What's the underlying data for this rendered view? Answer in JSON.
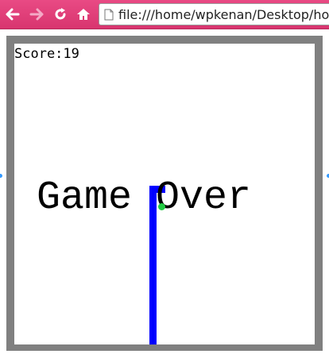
{
  "browser": {
    "url": "file:///home/wpkenan/Desktop/home",
    "icons": {
      "back": "back-arrow-icon",
      "forward": "forward-arrow-icon",
      "reload": "reload-icon",
      "home": "home-icon",
      "page": "page-icon"
    },
    "toolbar_color": "#e94a84"
  },
  "game": {
    "score_text": "Score:19",
    "game_over_text": "Game Over",
    "colors": {
      "border": "#808080",
      "board": "#ffffff",
      "snake": "#0000ff",
      "food": "#22cc44"
    }
  }
}
